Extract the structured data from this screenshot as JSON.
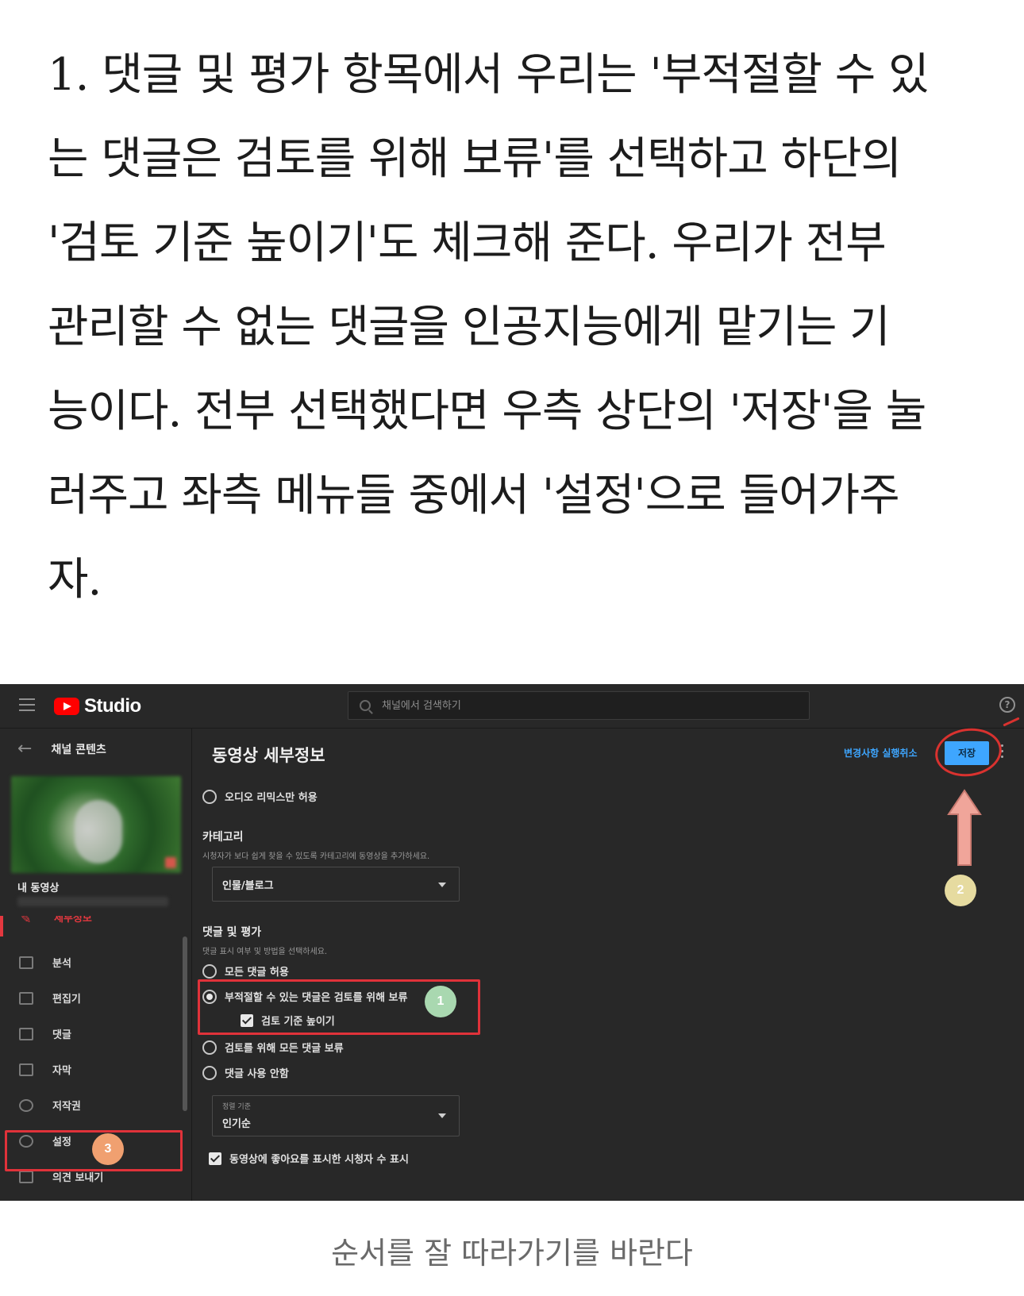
{
  "article": {
    "lines": [
      "1. 댓글 및 평가 항목에서 우리는 '부적절할 수 있",
      "는 댓글은 검토를 위해 보류'를 선택하고 하단의",
      "'검토 기준 높이기'도 체크해 준다. 우리가 전부",
      "관리할 수 없는 댓글을 인공지능에게 맡기는 기",
      "능이다. 전부 선택했다면 우측 상단의 '저장'을 눌",
      "러주고 좌측 메뉴들 중에서 '설정'으로 들어가주",
      "자."
    ]
  },
  "studio": {
    "logo_text": "Studio",
    "search_placeholder": "채널에서 검색하기",
    "help_glyph": "?",
    "sidebar": {
      "back_title": "채널 콘텐츠",
      "my_video": "내 동영상",
      "details_label": "세부정보",
      "items": [
        {
          "label": "분석",
          "icon": "analytics-icon"
        },
        {
          "label": "편집기",
          "icon": "editor-icon"
        },
        {
          "label": "댓글",
          "icon": "comments-icon"
        },
        {
          "label": "자막",
          "icon": "subtitles-icon"
        },
        {
          "label": "저작권",
          "icon": "copyright-icon"
        },
        {
          "label": "설정",
          "icon": "gear-icon"
        },
        {
          "label": "의견 보내기",
          "icon": "feedback-icon"
        }
      ]
    },
    "main": {
      "title": "동영상 세부정보",
      "undo_label": "변경사항 실행취소",
      "save_label": "저장",
      "audio_remix": "오디오 리믹스만 허용",
      "category": {
        "title": "카테고리",
        "desc": "시청자가 보다 쉽게 찾을 수 있도록 카테고리에 동영상을 추가하세요.",
        "value": "인물/블로그"
      },
      "comments": {
        "title": "댓글 및 평가",
        "desc": "댓글 표시 여부 및 방법을 선택하세요.",
        "options": [
          "모든 댓글 허용",
          "부적절할 수 있는 댓글은 검토를 위해 보류",
          "검토를 위해 모든 댓글 보류",
          "댓글 사용 안함"
        ],
        "selected_index": 1,
        "strict_label": "검토 기준 높이기",
        "strict_checked": true
      },
      "sort": {
        "label": "정렬 기준",
        "value": "인기순"
      },
      "likes_label": "동영상에 좋아요를 표시한 시청자 수 표시",
      "likes_checked": true
    },
    "annotations": {
      "badge_1": "1",
      "badge_2": "2",
      "badge_3": "3",
      "highlight_color": "#e0323a"
    },
    "colors": {
      "accent_blue": "#3ea6ff",
      "brand_red": "#ff0000",
      "background": "#282828"
    }
  },
  "caption": "순서를 잘 따라가기를 바란다"
}
